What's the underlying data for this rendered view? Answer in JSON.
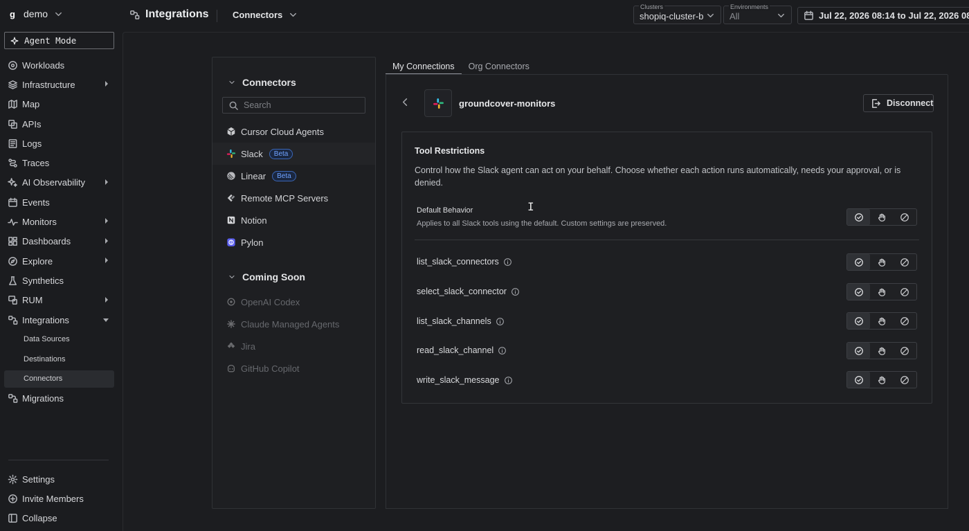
{
  "topbar": {
    "org_logo": "g",
    "org_name": "demo",
    "page_title": "Integrations",
    "breadcrumb": "Connectors",
    "clusters_label": "Clusters",
    "clusters_value": "shopiq-cluster-b",
    "environments_label": "Environments",
    "environments_value": "All",
    "date_range": "Jul 22, 2026 08:14 to Jul 22, 2026 08:"
  },
  "sidebar": {
    "agent_mode": "Agent Mode",
    "items": [
      {
        "label": "Workloads",
        "icon": "workloads-icon"
      },
      {
        "label": "Infrastructure",
        "icon": "layers-icon",
        "expandable": true
      },
      {
        "label": "Map",
        "icon": "map-icon"
      },
      {
        "label": "APIs",
        "icon": "api-icon"
      },
      {
        "label": "Logs",
        "icon": "logs-icon"
      },
      {
        "label": "Traces",
        "icon": "traces-icon"
      },
      {
        "label": "AI Observability",
        "icon": "sparkle-icon",
        "expandable": true
      },
      {
        "label": "Events",
        "icon": "calendar-icon"
      },
      {
        "label": "Monitors",
        "icon": "pulse-icon",
        "expandable": true
      },
      {
        "label": "Dashboards",
        "icon": "dashboard-icon",
        "expandable": true
      },
      {
        "label": "Explore",
        "icon": "compass-icon",
        "expandable": true
      },
      {
        "label": "Synthetics",
        "icon": "flask-icon"
      },
      {
        "label": "RUM",
        "icon": "rum-icon",
        "expandable": true
      },
      {
        "label": "Integrations",
        "icon": "integrations-icon",
        "expanded": true
      }
    ],
    "sub_items": [
      "Data Sources",
      "Destinations",
      "Connectors"
    ],
    "after_items": [
      {
        "label": "Migrations",
        "icon": "migrations-icon"
      }
    ],
    "bottom": [
      {
        "label": "Settings",
        "icon": "gear-icon"
      },
      {
        "label": "Invite Members",
        "icon": "plus-circle-icon"
      },
      {
        "label": "Collapse",
        "icon": "collapse-icon"
      }
    ]
  },
  "connectors_panel": {
    "heading": "Connectors",
    "search_placeholder": "Search",
    "items": [
      {
        "label": "Cursor Cloud Agents",
        "icon": "cursor-icon"
      },
      {
        "label": "Slack",
        "icon": "slack-icon",
        "badge": "Beta"
      },
      {
        "label": "Linear",
        "icon": "linear-icon",
        "badge": "Beta"
      },
      {
        "label": "Remote MCP Servers",
        "icon": "mcp-icon"
      },
      {
        "label": "Notion",
        "icon": "notion-icon"
      },
      {
        "label": "Pylon",
        "icon": "pylon-icon"
      }
    ],
    "coming_soon_heading": "Coming Soon",
    "coming_soon": [
      {
        "label": "OpenAI Codex",
        "icon": "openai-icon"
      },
      {
        "label": "Claude Managed Agents",
        "icon": "claude-icon"
      },
      {
        "label": "Jira",
        "icon": "jira-icon"
      },
      {
        "label": "GitHub Copilot",
        "icon": "copilot-icon"
      }
    ]
  },
  "tabs": [
    "My Connections",
    "Org Connectors"
  ],
  "detail": {
    "connection_name": "groundcover-monitors",
    "disconnect_label": "Disconnect",
    "tool_restrictions": {
      "title": "Tool Restrictions",
      "description": "Control how the Slack agent can act on your behalf. Choose whether each action runs automatically, needs your approval, or is denied.",
      "default_title": "Default Behavior",
      "default_subtitle": "Applies to all Slack tools using the default. Custom settings are preserved.",
      "tools": [
        "list_slack_connectors",
        "select_slack_connector",
        "list_slack_channels",
        "read_slack_channel",
        "write_slack_message"
      ],
      "options": [
        "allow-icon",
        "approval-hand-icon",
        "deny-icon"
      ]
    }
  },
  "colors": {
    "background": "#1b1c1f",
    "panel": "#1e1f22",
    "beta_badge": "#6fa2ff",
    "slack_green": "#2eb67d",
    "slack_blue": "#36c5f0",
    "slack_yellow": "#ecb22e",
    "slack_red": "#e01e5a"
  }
}
